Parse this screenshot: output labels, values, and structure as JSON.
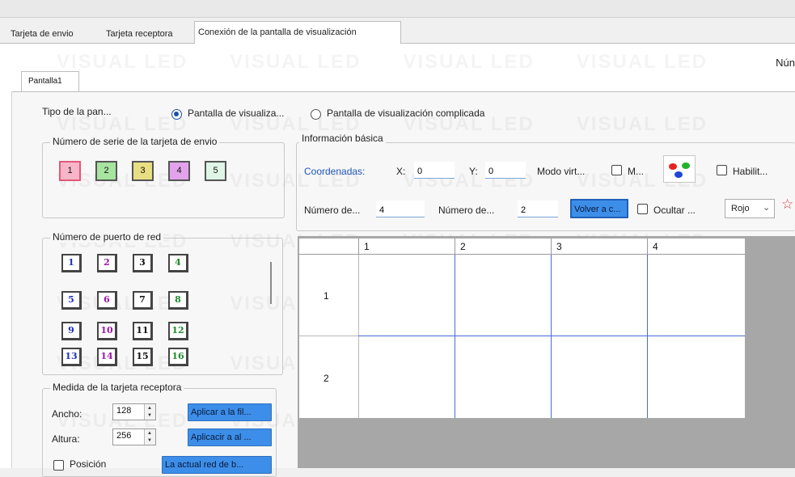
{
  "tabs": [
    {
      "label": "Tarjeta de envio"
    },
    {
      "label": "Tarjeta receptora"
    },
    {
      "label": "Conexión de la pantalla de visualización"
    }
  ],
  "watermark": {
    "text": "VISUAL LED"
  },
  "header_right": {
    "text": "Nún"
  },
  "screen_tab": {
    "label": "Pantalla1"
  },
  "screen_type": {
    "label": "Tipo de la pan...",
    "option_simple": "Pantalla de visualiza...",
    "option_complex": "Pantalla de visualización complicada"
  },
  "sending_cards": {
    "title": "Número de serie de la tarjeta de envio",
    "cards": [
      {
        "label": "1",
        "color": "#f8b5c8"
      },
      {
        "label": "2",
        "color": "#a6e4a0"
      },
      {
        "label": "3",
        "color": "#e8de82"
      },
      {
        "label": "4",
        "color": "#e2a2ec"
      },
      {
        "label": "5",
        "color": "#dff5e6"
      }
    ]
  },
  "network_ports": {
    "title": "Número de puerto de red",
    "ports": [
      {
        "label": "1",
        "color": "#1d2fbf"
      },
      {
        "label": "2",
        "color": "#9a18a8"
      },
      {
        "label": "3",
        "color": "#111111"
      },
      {
        "label": "4",
        "color": "#1e8a2c"
      },
      {
        "label": "5",
        "color": "#1d2fbf"
      },
      {
        "label": "6",
        "color": "#9a18a8"
      },
      {
        "label": "7",
        "color": "#111111"
      },
      {
        "label": "8",
        "color": "#1e8a2c"
      },
      {
        "label": "9",
        "color": "#1d2fbf"
      },
      {
        "label": "10",
        "color": "#9a18a8"
      },
      {
        "label": "11",
        "color": "#111111"
      },
      {
        "label": "12",
        "color": "#1e8a2c"
      },
      {
        "label": "13",
        "color": "#1d2fbf"
      },
      {
        "label": "14",
        "color": "#9a18a8"
      },
      {
        "label": "15",
        "color": "#111111"
      },
      {
        "label": "16",
        "color": "#1e8a2c"
      }
    ]
  },
  "receiver_size": {
    "title": "Medida de la tarjeta receptora",
    "width_label": "Ancho:",
    "width_value": "128",
    "height_label": "Altura:",
    "height_value": "256",
    "apply_row_button": "Aplicar a la fil...",
    "apply_all_button": "Aplicacir a al ...",
    "position_label": "Posición",
    "current_network_button": "La actual red de b..."
  },
  "basic_info": {
    "title": "Información básica",
    "coords_label": "Coordenadas:",
    "x_label": "X:",
    "x_value": "0",
    "y_label": "Y:",
    "y_value": "0",
    "virtual_mode_label": "Modo virt...",
    "m_label": "M...",
    "enable_label": "Habilit...",
    "rows_label": "Número de...",
    "rows_value": "4",
    "cols_label": "Número de...",
    "cols_value": "2",
    "reset_button": "Volver a c...",
    "hide_label": "Ocultar ...",
    "color_select": "Rojo"
  },
  "grid": {
    "col_headers": [
      "1",
      "2",
      "3",
      "4"
    ],
    "row_headers": [
      "1",
      "2"
    ]
  },
  "colors": {
    "accent_blue": "#3d8ee8",
    "grid_line": "#4a6bd6",
    "grid_background": "#a7a7a7"
  }
}
